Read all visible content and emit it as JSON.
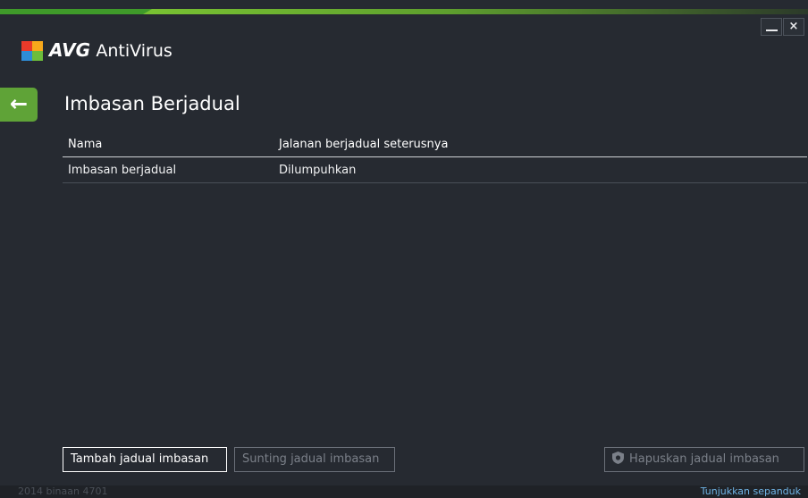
{
  "window": {
    "brand_prefix": "AVG",
    "brand_product": "AntiVirus",
    "minimize_label": "",
    "close_label": "×"
  },
  "page": {
    "title": "Imbasan Berjadual",
    "back_label": "←"
  },
  "table": {
    "columns": [
      "Nama",
      "Jalanan berjadual seterusnya"
    ],
    "rows": [
      {
        "name": "Imbasan berjadual",
        "next_run": "Dilumpuhkan"
      }
    ]
  },
  "buttons": {
    "add": "Tambah jadual imbasan",
    "edit": "Sunting jadual imbasan",
    "delete": "Hapuskan jadual imbasan"
  },
  "footer": {
    "build": "2014  binaan 4701",
    "show_notification": "Tunjukkan sepanduk"
  },
  "colors": {
    "accent_green": "#5fa337",
    "background": "#262a31",
    "link": "#6fb4e6"
  },
  "icons": {
    "back": "arrow-left-icon",
    "delete": "shield-icon",
    "close": "close-icon",
    "minimize": "minimize-icon",
    "logo": "avg-logo-icon"
  }
}
